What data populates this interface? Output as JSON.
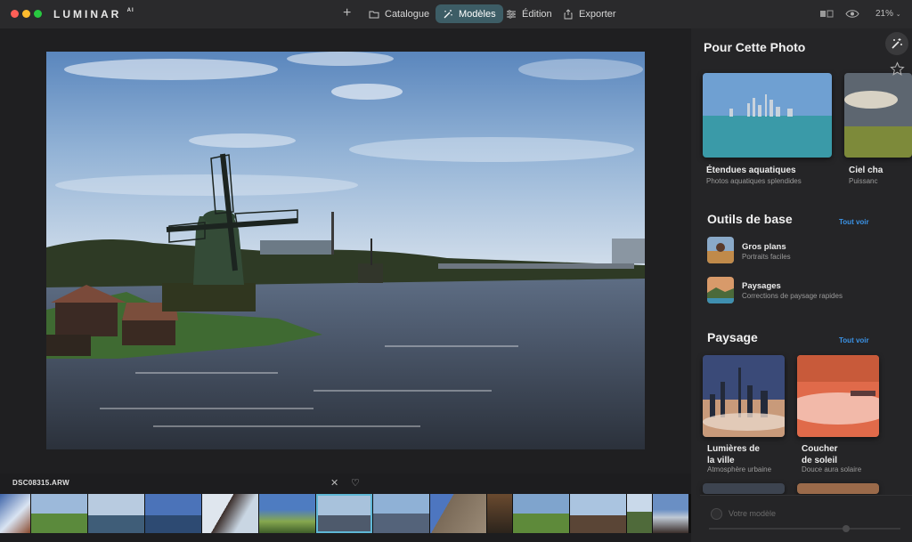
{
  "app": {
    "logo": "LUMINAR",
    "logo_suffix": "AI"
  },
  "toolbar": {
    "catalogue": "Catalogue",
    "models": "Modèles",
    "edition": "Édition",
    "export": "Exporter",
    "zoom": "21%"
  },
  "file": {
    "name": "DSC08315.ARW"
  },
  "sidebar": {
    "for_photo": {
      "title": "Pour Cette Photo",
      "cards": [
        {
          "title": "Étendues aquatiques",
          "sub": "Photos aquatiques splendides"
        },
        {
          "title": "Ciel cha",
          "sub": "Puissanc"
        }
      ]
    },
    "basic": {
      "title": "Outils de base",
      "see_all": "Tout voir",
      "items": [
        {
          "title": "Gros plans",
          "sub": "Portraits faciles"
        },
        {
          "title": "Paysages",
          "sub": "Corrections de paysage rapides"
        }
      ]
    },
    "landscape": {
      "title": "Paysage",
      "see_all": "Tout voir",
      "cards": [
        {
          "title_l1": "Lumières de",
          "title_l2": "la ville",
          "sub": "Atmosphère urbaine"
        },
        {
          "title_l1": "Coucher",
          "title_l2": "de soleil",
          "sub": "Douce aura solaire"
        }
      ]
    },
    "my_model": "Votre modèle"
  },
  "colors": {
    "accent": "#3d5d66",
    "link": "#3b93e6",
    "selection": "#5fb7d6"
  }
}
